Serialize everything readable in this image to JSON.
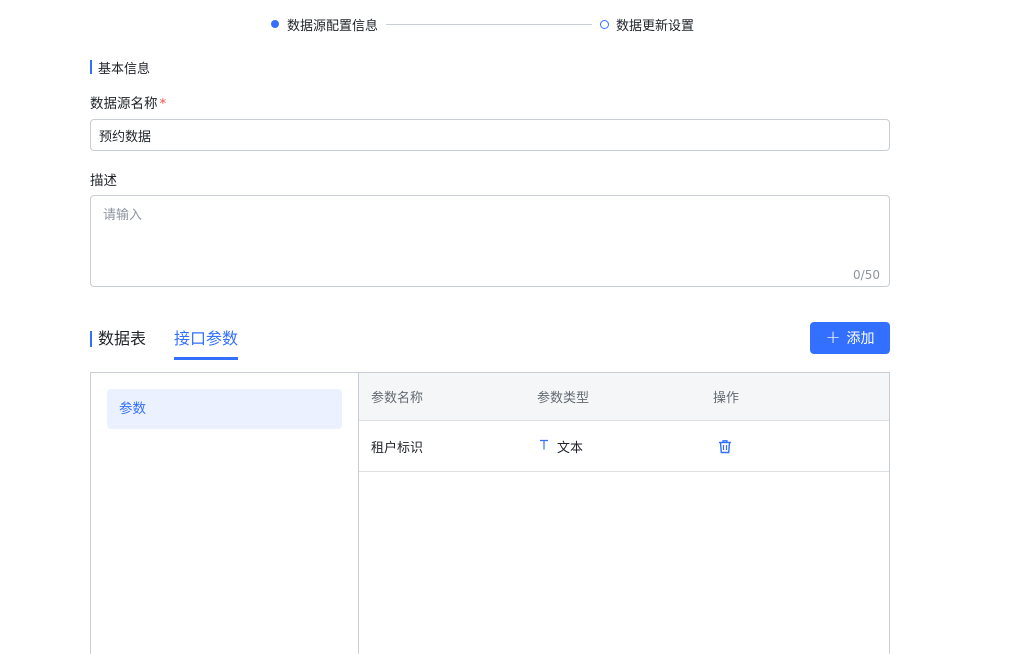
{
  "stepper": {
    "steps": [
      {
        "label": "数据源配置信息",
        "state": "active"
      },
      {
        "label": "数据更新设置",
        "state": "pending"
      }
    ]
  },
  "basic_info": {
    "section_title": "基本信息",
    "name_label": "数据源名称",
    "name_required_mark": "*",
    "name_value": "预约数据",
    "desc_label": "描述",
    "desc_placeholder": "请输入",
    "desc_counter": "0/50"
  },
  "tabs": {
    "items": [
      {
        "label": "数据表",
        "active": false
      },
      {
        "label": "接口参数",
        "active": true
      }
    ],
    "add_button_label": "添加"
  },
  "params_panel": {
    "left_items": [
      {
        "label": "参数",
        "selected": true
      }
    ],
    "columns": [
      "参数名称",
      "参数类型",
      "操作"
    ],
    "rows": [
      {
        "name": "租户标识",
        "type_icon": "text-type-icon",
        "type": "文本",
        "action_icon": "trash-icon"
      }
    ]
  },
  "colors": {
    "accent": "#3370ff",
    "required": "#f54a45",
    "border": "#c9cdd4"
  }
}
